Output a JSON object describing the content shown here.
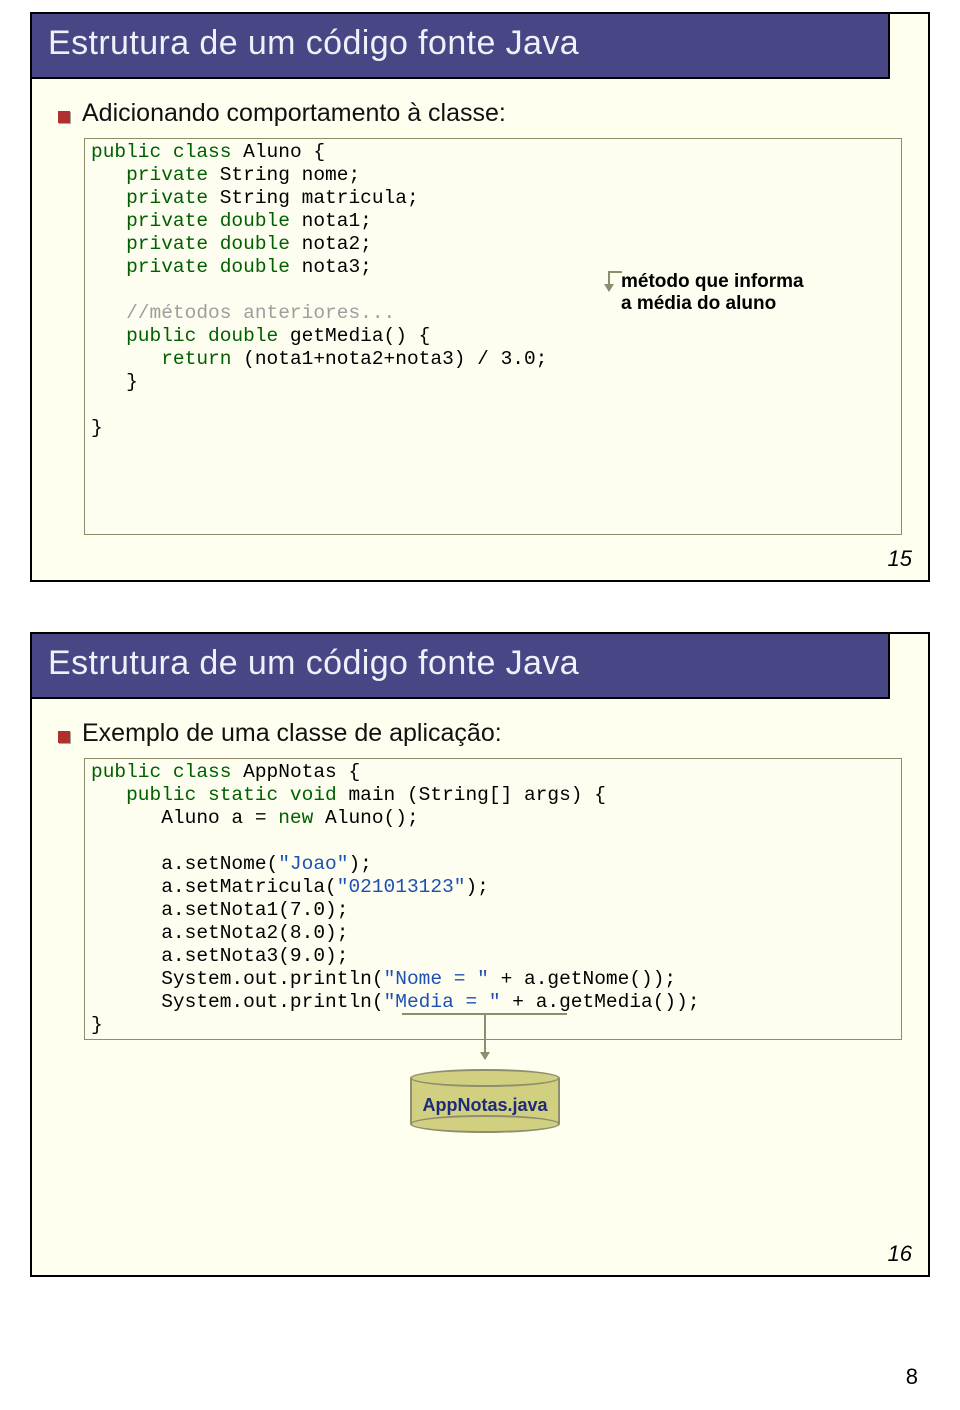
{
  "slide1": {
    "title": "Estrutura de um código fonte Java",
    "heading": "Adicionando comportamento à classe:",
    "code": {
      "l1a": "public class",
      "l1b": " Aluno {",
      "l2a": "   private",
      "l2b": " String nome;",
      "l3a": "   private",
      "l3b": " String matricula;",
      "l4a": "   private double",
      "l4b": " nota1;",
      "l5a": "   private double",
      "l5b": " nota2;",
      "l6a": "   private double",
      "l6b": " nota3;",
      "l7": "   //métodos anteriores...",
      "l8a": "   public double",
      "l8b": " getMedia() {",
      "l9a": "      return",
      "l9b": " (nota1+nota2+nota3) / 3.0;",
      "l10": "   }",
      "l11": "}"
    },
    "callout": "método que informa\na média do aluno",
    "num": "15"
  },
  "slide2": {
    "title": "Estrutura de um código fonte Java",
    "heading": "Exemplo de uma classe de aplicação:",
    "code": {
      "l1a": "public class",
      "l1b": " AppNotas {",
      "l2a": "   public static void",
      "l2b": " main (String[] args) {",
      "l3a": "      Aluno a = ",
      "l3b": "new",
      "l3c": " Aluno();",
      "l4a": "      a.setNome(",
      "l4b": "\"Joao\"",
      "l4c": ");",
      "l5a": "      a.setMatricula(",
      "l5b": "\"021013123\"",
      "l5c": ");",
      "l6": "      a.setNota1(7.0);",
      "l7": "      a.setNota2(8.0);",
      "l8": "      a.setNota3(9.0);",
      "l9a": "      System.out.println(",
      "l9b": "\"Nome = \"",
      "l9c": " + a.getNome());",
      "l10a": "      System.out.println(",
      "l10b": "\"Media = \"",
      "l10c": " + a.getMedia());",
      "l11": "}"
    },
    "cylinder": "AppNotas.java",
    "num": "16"
  },
  "page_num": "8"
}
